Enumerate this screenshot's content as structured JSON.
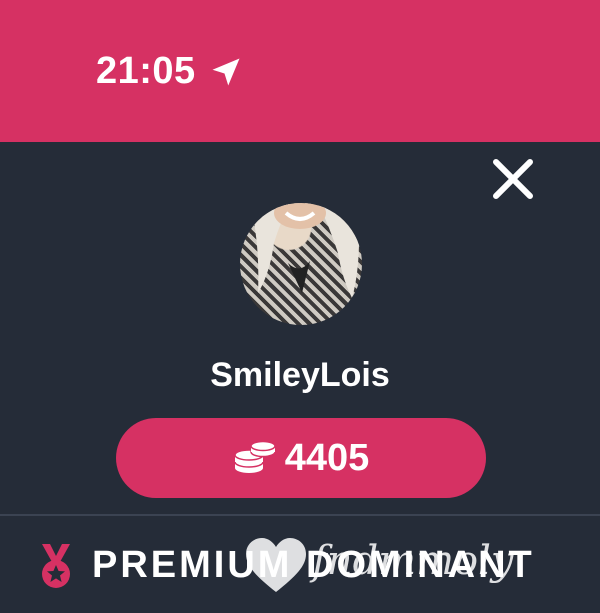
{
  "status_bar": {
    "time": "21:05",
    "location_icon": "location-arrow-icon",
    "background": "#d63163"
  },
  "profile": {
    "username": "SmileyLois",
    "avatar_icon": "avatar-photo",
    "close_icon": "close-icon"
  },
  "coins": {
    "value": "4405",
    "icon": "coins-stack-icon",
    "button_color": "#d63163"
  },
  "premium": {
    "label": "PREMIUM DOMINANT",
    "icon": "medal-star-icon",
    "icon_color": "#d63163"
  },
  "watermark": {
    "text": "fndmmoly",
    "icon": "heart-icon"
  },
  "colors": {
    "panel": "#252c38",
    "accent": "#d63163",
    "text": "#ffffff"
  }
}
